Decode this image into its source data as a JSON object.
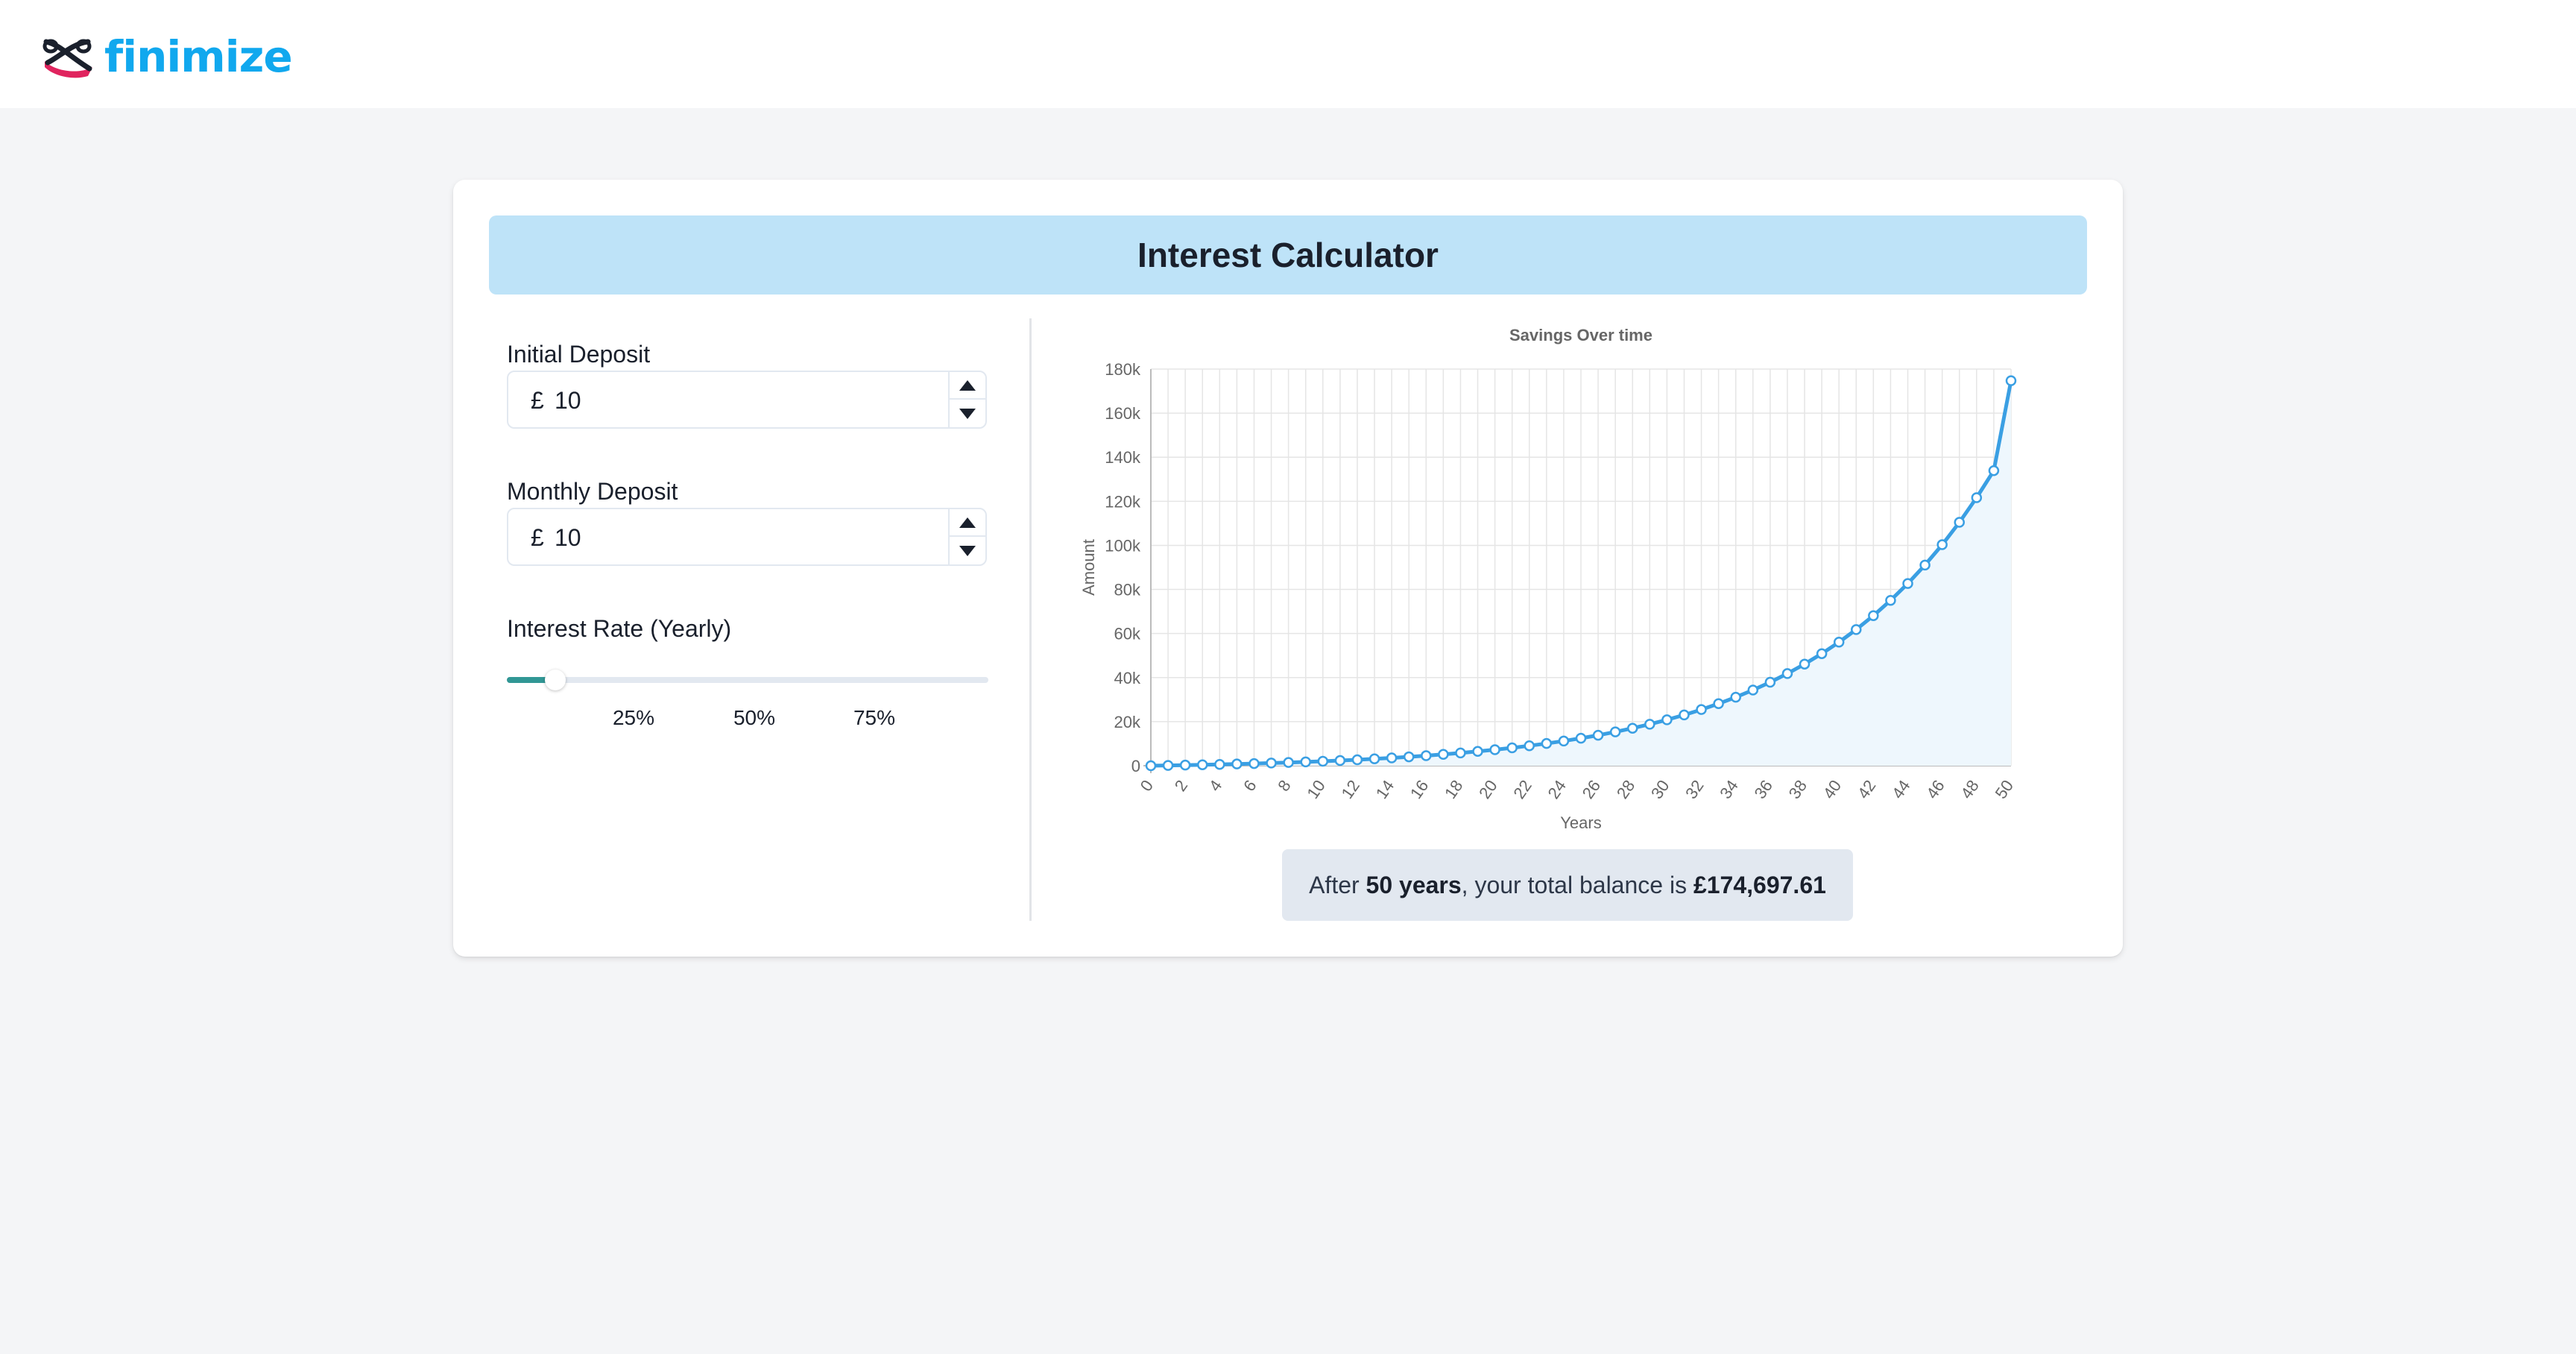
{
  "brand": {
    "name": "finimize",
    "icon": "finimize-logo-icon",
    "color": "#11a8ee"
  },
  "calculator": {
    "title": "Interest Calculator",
    "initial_deposit": {
      "label": "Initial Deposit",
      "currency": "£",
      "value": "10"
    },
    "monthly_deposit": {
      "label": "Monthly Deposit",
      "currency": "£",
      "value": "10"
    },
    "interest_rate": {
      "label": "Interest Rate (Yearly)",
      "value_fraction": 0.1,
      "marks": [
        "25%",
        "50%",
        "75%"
      ]
    },
    "result": {
      "prefix": "After ",
      "years": "50 years",
      "middle": ", your total balance is ",
      "amount": "£174,697.61"
    }
  },
  "colors": {
    "header_bg": "#bee3f8",
    "slider_fill": "#319795",
    "line": "#3a9fe3",
    "area": "#eef7fd"
  },
  "chart_data": {
    "type": "line",
    "title": "Savings Over time",
    "xlabel": "Years",
    "ylabel": "Amount",
    "xlim": [
      0,
      50
    ],
    "ylim": [
      0,
      180000
    ],
    "y_ticks": [
      "0",
      "20k",
      "40k",
      "60k",
      "80k",
      "100k",
      "120k",
      "140k",
      "160k",
      "180k"
    ],
    "x_ticks": [
      "0",
      "2",
      "4",
      "6",
      "8",
      "10",
      "12",
      "14",
      "16",
      "18",
      "20",
      "22",
      "24",
      "26",
      "28",
      "30",
      "32",
      "34",
      "36",
      "38",
      "40",
      "42",
      "44",
      "46",
      "48",
      "50"
    ],
    "grid": true,
    "fill_area": true,
    "series": [
      {
        "x": [
          0,
          1,
          2,
          3,
          4,
          5,
          6,
          7,
          8,
          9,
          10,
          11,
          12,
          13,
          14,
          15,
          16,
          17,
          18,
          19,
          20,
          21,
          22,
          23,
          24,
          25,
          26,
          27,
          28,
          29,
          30,
          31,
          32,
          33,
          34,
          35,
          36,
          37,
          38,
          39,
          40,
          41,
          42,
          43,
          44,
          45,
          46,
          47,
          48,
          49,
          50
        ],
        "values": [
          10,
          137,
          277,
          430,
          599,
          785,
          989,
          1214,
          1461,
          1733,
          2032,
          2360,
          2722,
          3120,
          3557,
          4039,
          4568,
          5150,
          5790,
          6494,
          7268,
          8120,
          9057,
          10088,
          11222,
          12469,
          13841,
          15350,
          17010,
          18836,
          20845,
          23055,
          25485,
          28159,
          31100,
          34336,
          37896,
          41811,
          46118,
          50855,
          56067,
          61799,
          68106,
          75043,
          82674,
          91068,
          100302,
          110459,
          121631,
          133921,
          174698
        ]
      }
    ]
  }
}
